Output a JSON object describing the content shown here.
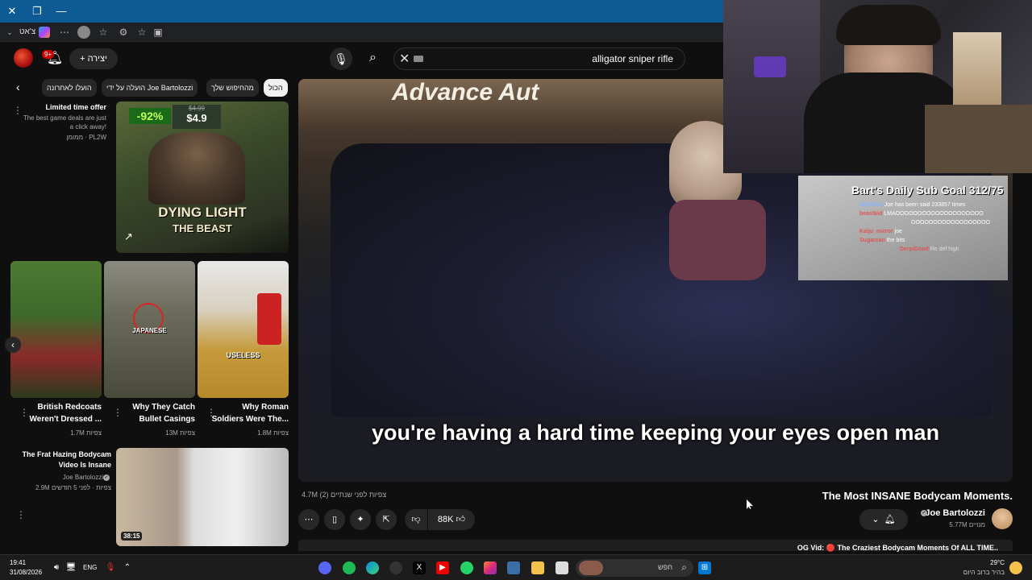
{
  "window": {
    "close": "✕",
    "restore": "❐",
    "minimize": "—"
  },
  "browser": {
    "profile_label": "צ'אט",
    "menu_icon": "more-icon"
  },
  "header": {
    "create_label": "+ יצירה",
    "notif_badge": "9+",
    "search_value": "alligator sniper rifle",
    "search_clear": "✕"
  },
  "chips": [
    {
      "label": "הכול",
      "active": true
    },
    {
      "label": "מהחיפוש שלך",
      "active": false
    },
    {
      "label": "הועלה על ידי Joe Bartolozzi",
      "active": false
    },
    {
      "label": "הועלו לאחרונה",
      "active": false
    }
  ],
  "ad": {
    "title": "Limited time offer",
    "desc1": "The best game deals are just",
    "desc2": "a click away!",
    "sponsor": "ממומן · PL2W",
    "discount": "-92%",
    "old_price": "$4.99",
    "price": "$4.9",
    "game_title1": "DYING LIGHT",
    "game_title2": "THE BEAST"
  },
  "shorts": [
    {
      "title1": "British Redcoats",
      "title2": "Weren't Dressed ...",
      "views": "1.7M צפיות",
      "overlay": ""
    },
    {
      "title1": "Why They Catch",
      "title2": "Bullet Casings",
      "views": "13M צפיות",
      "overlay": "JAPANESE"
    },
    {
      "title1": "Why Roman",
      "title2": "Soldiers Were The...",
      "views": "1.8M צפיות",
      "overlay": "USELESS"
    }
  ],
  "related": {
    "title1": "The Frat Hazing Bodycam",
    "title2": "Video Is Insane",
    "channel": "Joe Bartolozzi",
    "meta": "2.9M צפיות · לפני 5 חודשים",
    "duration": "38:15"
  },
  "player": {
    "sign_text": "Advance Aut",
    "subtitle": "you're having a hard time keeping your eyes open man"
  },
  "overlay": {
    "goal": "Bart's Daily Sub Goal 312/75",
    "chat": [
      {
        "user": "Nighthot",
        "msg": "Joe has been said 233857 times",
        "color": "#8ab4f8"
      },
      {
        "user": "beastkid",
        "msg": "LMAOOOOOOOOOOOOOOOOOOOO",
        "color": "#e05555"
      },
      {
        "user": "",
        "msg": "OOOOOOOOOOOOOOOOOO",
        "color": "#e05555"
      },
      {
        "user": "Kaiju_mirror",
        "msg": "joe",
        "color": "#e05555"
      },
      {
        "user": "Sugarcan",
        "msg": "the bits",
        "color": "#e05555"
      },
      {
        "user": "DerpiDood",
        "msg": "Ro def high",
        "color": "#e05555"
      }
    ]
  },
  "video": {
    "title": "The Most INSANE Bodycam Moments.",
    "views_line": "4.7M צפיות  לפני שנתיים  (2)",
    "channel": "Joe Bartolozzi",
    "subscribers": "5.77M מנויים",
    "likes": "88K",
    "description_preview": "OG Vid: 🔴 The Craziest Bodycam Moments Of ALL TIME.."
  },
  "taskbar": {
    "time": "19:41",
    "date": "31/08/2026",
    "lang": "ENG",
    "search_placeholder": "חפש",
    "weather_temp": "29°C",
    "weather_desc": "בהיר ברוב היום"
  },
  "colors": {
    "accent_red": "#cc0000",
    "titlebar_blue": "#0d5a95",
    "dark_bg": "#0f0f0f"
  }
}
